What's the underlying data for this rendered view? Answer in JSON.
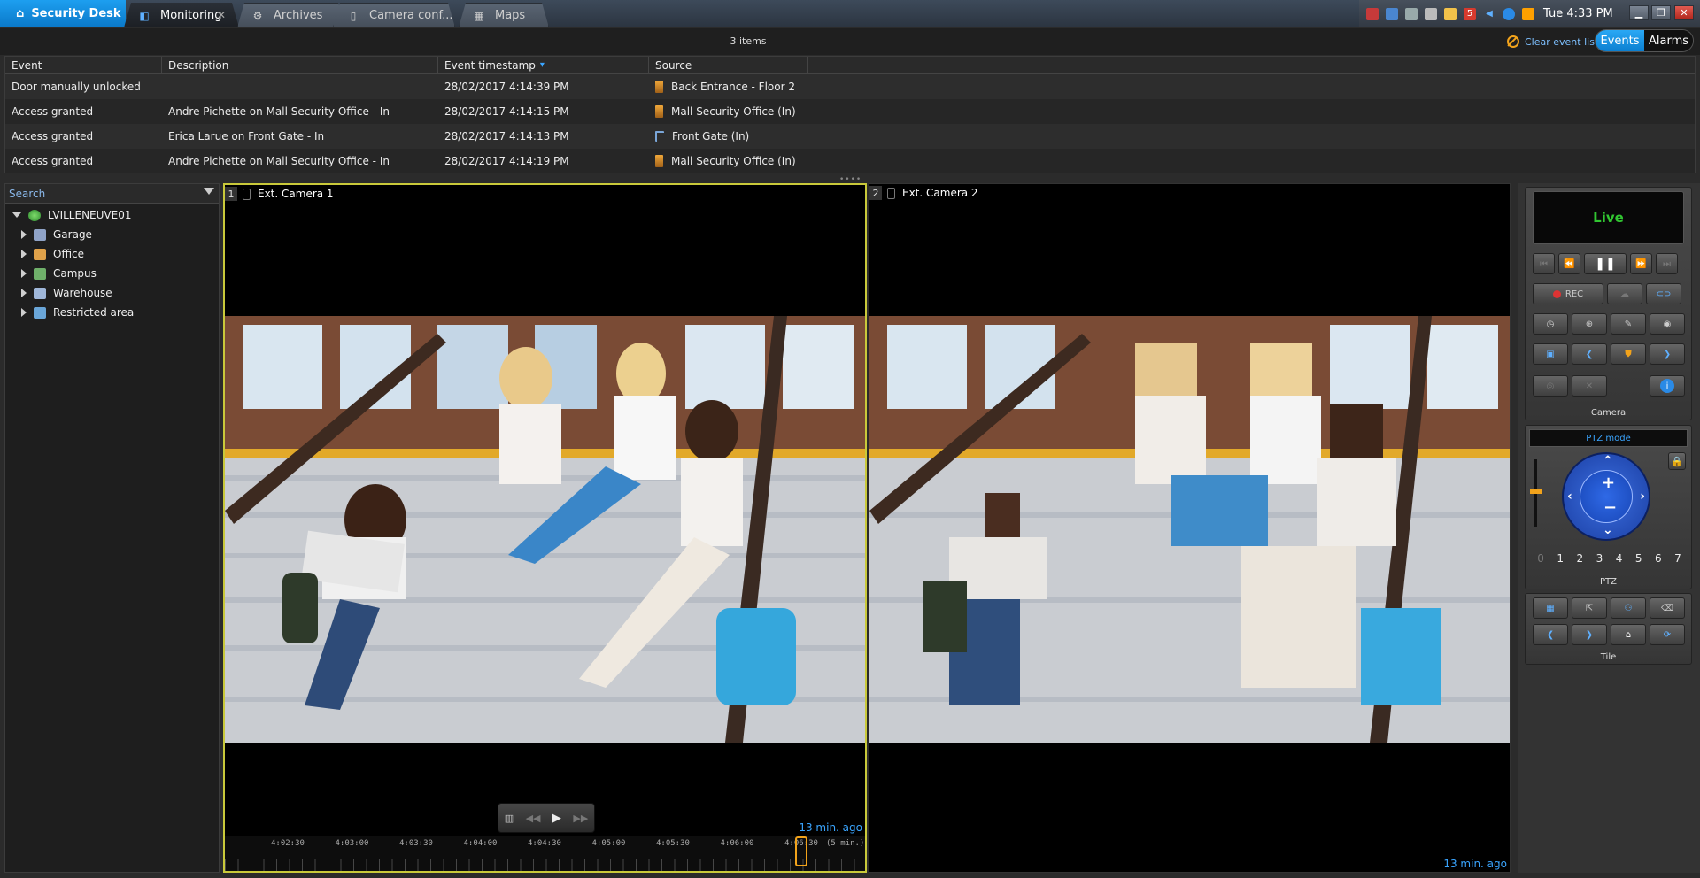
{
  "app": {
    "title": "Security Desk"
  },
  "tabs": [
    {
      "label": "Monitoring",
      "close": "✕"
    },
    {
      "label": "Archives"
    },
    {
      "label": "Camera conf..."
    },
    {
      "label": "Maps"
    }
  ],
  "tray": {
    "clock": "Tue 4:33 PM",
    "badge": "5"
  },
  "events": {
    "count": "3 items",
    "clear_label": "Clear event list",
    "toggle": {
      "events": "Events",
      "alarms": "Alarms"
    },
    "columns": [
      "Event",
      "Description",
      "Event timestamp",
      "Source"
    ],
    "sort_marker": "▾",
    "rows": [
      {
        "event": "Door manually unlocked",
        "description": "",
        "timestamp": "28/02/2017 4:14:39 PM",
        "source": "Back Entrance - Floor 2"
      },
      {
        "event": "Access granted",
        "description": "Andre Pichette on Mall Security Office - In",
        "timestamp": "28/02/2017 4:14:15 PM",
        "source": "Mall Security Office (In)"
      },
      {
        "event": "Access granted",
        "description": "Erica Larue on Front Gate - In",
        "timestamp": "28/02/2017 4:14:13 PM",
        "source": "Front Gate (In)"
      },
      {
        "event": "Access granted",
        "description": "Andre Pichette on Mall Security Office - In",
        "timestamp": "28/02/2017 4:14:19 PM",
        "source": "Mall Security Office (In)"
      }
    ]
  },
  "tree": {
    "search_placeholder": "Search",
    "root": "LVILLENEUVE01",
    "items": [
      "Garage",
      "Office",
      "Campus",
      "Warehouse",
      "Restricted area"
    ],
    "colors": {
      "Garage": "#8fa3c7",
      "Office": "#e0a24a",
      "Campus": "#6fb06a",
      "Warehouse": "#9fb7d9",
      "Restricted area": "#6aa6d8"
    }
  },
  "tiles": [
    {
      "num": "1",
      "name": "Ext. Camera 1",
      "ago": "13 min. ago"
    },
    {
      "num": "2",
      "name": "Ext. Camera 2",
      "ago": "13 min. ago"
    }
  ],
  "timeline": {
    "labels": [
      "4:02:30",
      "4:03:00",
      "4:03:30",
      "4:04:00",
      "4:04:30",
      "4:05:00",
      "4:05:30",
      "4:06:00",
      "4:06:30"
    ],
    "scale": "(5 min.)"
  },
  "panel": {
    "live": "Live",
    "rec": "REC",
    "camera_caption": "Camera",
    "ptz_mode": "PTZ mode",
    "presets": [
      "0",
      "1",
      "2",
      "3",
      "4",
      "5",
      "6",
      "7"
    ],
    "ptz_caption": "PTZ",
    "tile_caption": "Tile",
    "accent": "#0b7fd0",
    "live_color": "#31c531"
  }
}
